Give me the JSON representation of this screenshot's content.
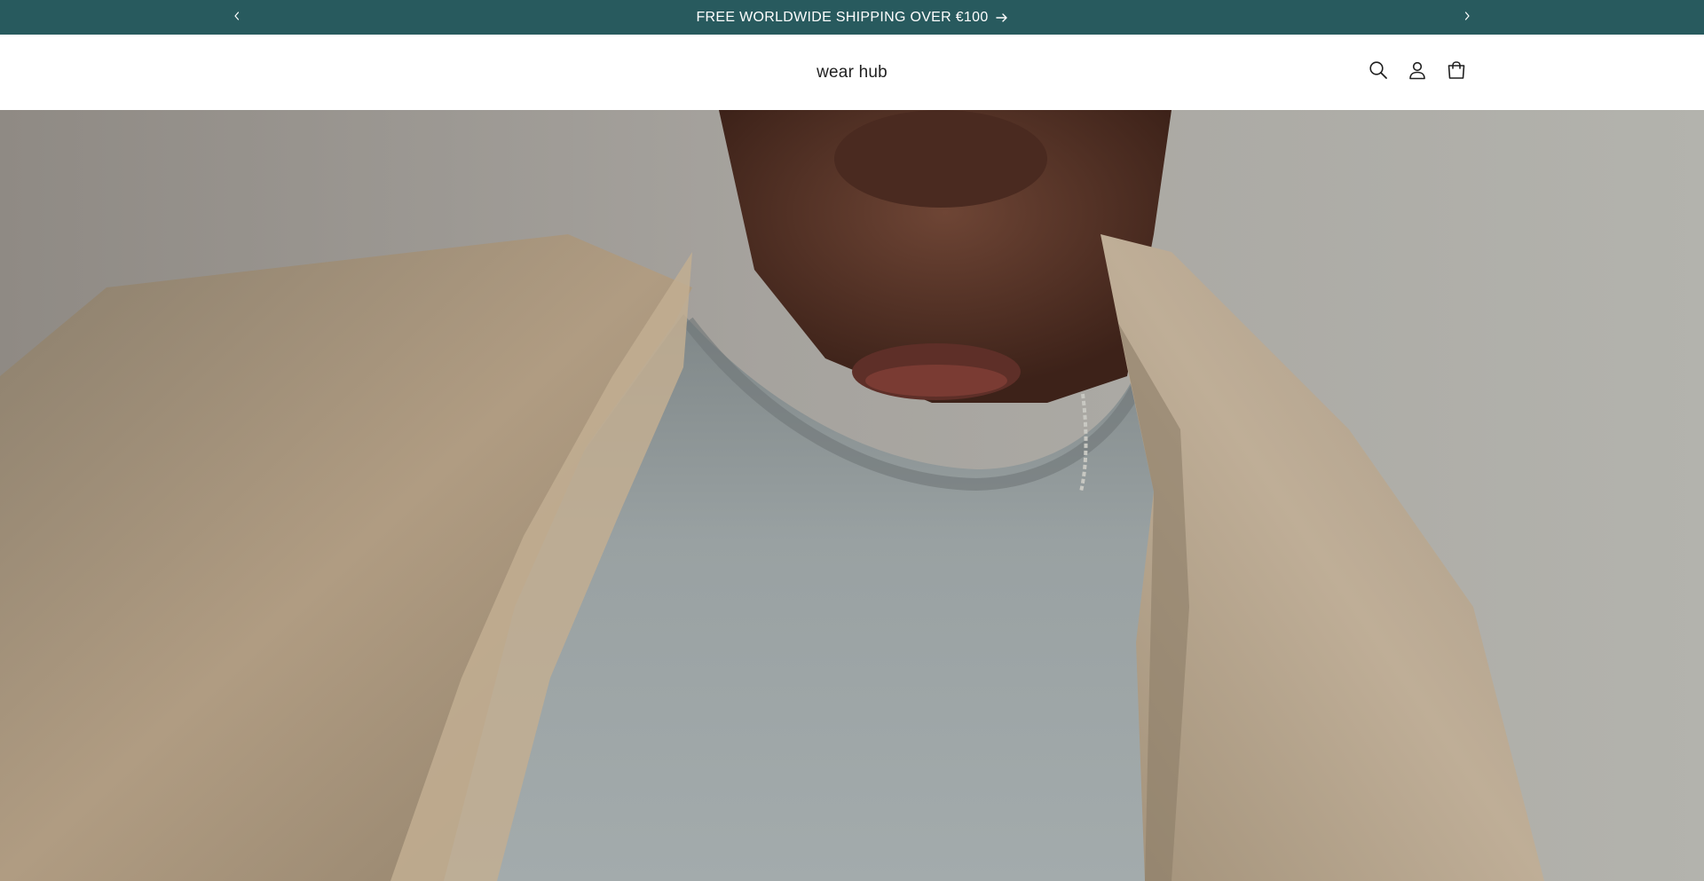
{
  "announcement": {
    "message": "FREE WORLDWIDE SHIPPING OVER €100",
    "prev_icon": "chevron-left-icon",
    "next_icon": "chevron-right-icon",
    "arrow_icon": "arrow-right-icon",
    "background_color": "#285a5e",
    "text_color": "#ffffff"
  },
  "header": {
    "logo": "wear hub",
    "icons": [
      "search-icon",
      "account-icon",
      "cart-icon"
    ]
  },
  "hero": {
    "image": "man in grey t-shirt and beige coat"
  }
}
